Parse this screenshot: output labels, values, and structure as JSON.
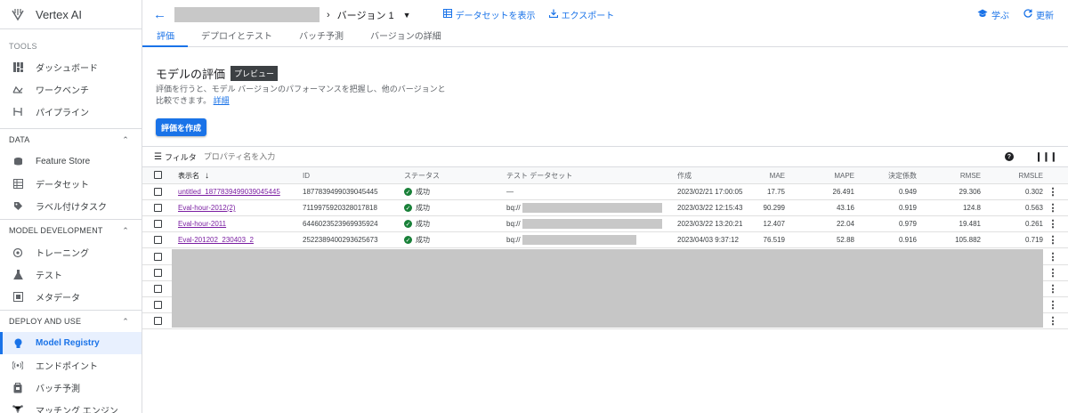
{
  "app": {
    "name": "Vertex AI"
  },
  "sidebar": {
    "tools_label": "TOOLS",
    "tools": [
      {
        "label": "ダッシュボード",
        "icon": "dashboard-icon"
      },
      {
        "label": "ワークベンチ",
        "icon": "workbench-icon"
      },
      {
        "label": "パイプライン",
        "icon": "pipeline-icon"
      }
    ],
    "data_label": "DATA",
    "data": [
      {
        "label": "Feature Store",
        "icon": "feature-store-icon"
      },
      {
        "label": "データセット",
        "icon": "dataset-icon"
      },
      {
        "label": "ラベル付けタスク",
        "icon": "label-icon"
      }
    ],
    "model_dev_label": "MODEL DEVELOPMENT",
    "model_dev": [
      {
        "label": "トレーニング",
        "icon": "training-icon"
      },
      {
        "label": "テスト",
        "icon": "experiment-icon"
      },
      {
        "label": "メタデータ",
        "icon": "metadata-icon"
      }
    ],
    "deploy_label": "DEPLOY AND USE",
    "deploy": [
      {
        "label": "Model Registry",
        "icon": "lightbulb-icon",
        "active": true
      },
      {
        "label": "エンドポイント",
        "icon": "endpoint-icon"
      },
      {
        "label": "バッチ予測",
        "icon": "batch-icon"
      },
      {
        "label": "マッチング エンジン",
        "icon": "matching-icon"
      }
    ]
  },
  "header": {
    "version": "バージョン 1",
    "show_dataset": "データセットを表示",
    "export": "エクスポート",
    "learn": "学ぶ",
    "refresh": "更新"
  },
  "tabs": [
    "評価",
    "デプロイとテスト",
    "バッチ予測",
    "バージョンの詳細"
  ],
  "evaluation": {
    "title": "モデルの評価",
    "badge": "プレビュー",
    "description": "評価を行うと、モデル バージョンのパフォーマンスを把握し、他のバージョンと比較できます。",
    "details_link": "詳細",
    "create_button": "評価を作成"
  },
  "filter": {
    "label": "フィルタ",
    "placeholder": "プロパティ名を入力"
  },
  "table": {
    "columns": {
      "name": "表示名",
      "id": "ID",
      "status": "ステータス",
      "dataset": "テスト データセット",
      "created": "作成",
      "mae": "MAE",
      "mape": "MAPE",
      "r2": "決定係数",
      "rmse": "RMSE",
      "rmsle": "RMSLE"
    },
    "rows": [
      {
        "name": "untitled_1877839499039045445",
        "id": "1877839499039045445",
        "status": "成功",
        "dataset": "—",
        "created": "2023/02/21 17:00:05",
        "mae": "17.75",
        "mape": "26.491",
        "r2": "0.949",
        "rmse": "29.306",
        "rmsle": "0.302"
      },
      {
        "name": "Eval-hour-2012(2)",
        "id": "7119975920328017818",
        "status": "成功",
        "dataset": "bq://",
        "created": "2023/03/22 12:15:43",
        "mae": "90.299",
        "mape": "43.16",
        "r2": "0.919",
        "rmse": "124.8",
        "rmsle": "0.563"
      },
      {
        "name": "Eval-hour-2011",
        "id": "6446023523969935924",
        "status": "成功",
        "dataset": "bq://",
        "created": "2023/03/22 13:20:21",
        "mae": "12.407",
        "mape": "22.04",
        "r2": "0.979",
        "rmse": "19.481",
        "rmsle": "0.261"
      },
      {
        "name": "Eval-201202_230403_2",
        "id": "2522389400293625673",
        "status": "成功",
        "dataset": "bq://",
        "created": "2023/04/03 9:37:12",
        "mae": "76.519",
        "mape": "52.88",
        "r2": "0.916",
        "rmse": "105.882",
        "rmsle": "0.719"
      }
    ]
  }
}
